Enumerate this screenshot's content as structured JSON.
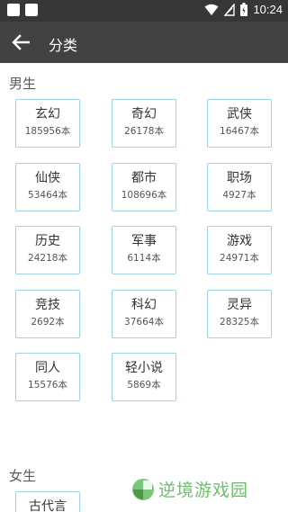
{
  "status_bar": {
    "time": "10:24",
    "icons": [
      "wifi-icon",
      "signal-icon",
      "battery-icon"
    ]
  },
  "header": {
    "title": "分类",
    "back_icon": "arrow-left-icon"
  },
  "male": {
    "title": "男生",
    "items": [
      {
        "name": "玄幻",
        "count": "185956本"
      },
      {
        "name": "奇幻",
        "count": "26178本"
      },
      {
        "name": "武侠",
        "count": "16467本"
      },
      {
        "name": "仙侠",
        "count": "53464本"
      },
      {
        "name": "都市",
        "count": "108696本"
      },
      {
        "name": "职场",
        "count": "4927本"
      },
      {
        "name": "历史",
        "count": "24218本"
      },
      {
        "name": "军事",
        "count": "6114本"
      },
      {
        "name": "游戏",
        "count": "24971本"
      },
      {
        "name": "竞技",
        "count": "2692本"
      },
      {
        "name": "科幻",
        "count": "37664本"
      },
      {
        "name": "灵异",
        "count": "28325本"
      },
      {
        "name": "同人",
        "count": "15576本"
      },
      {
        "name": "轻小说",
        "count": "5869本"
      }
    ]
  },
  "female": {
    "title": "女生",
    "items": [
      {
        "name": "古代言"
      }
    ]
  },
  "watermark": {
    "text": "逆境游戏园"
  },
  "colors": {
    "app_bar": "#424242",
    "status_bar": "#373737",
    "card_border": "#9fd3e8",
    "watermark": "#6fbf6f"
  }
}
